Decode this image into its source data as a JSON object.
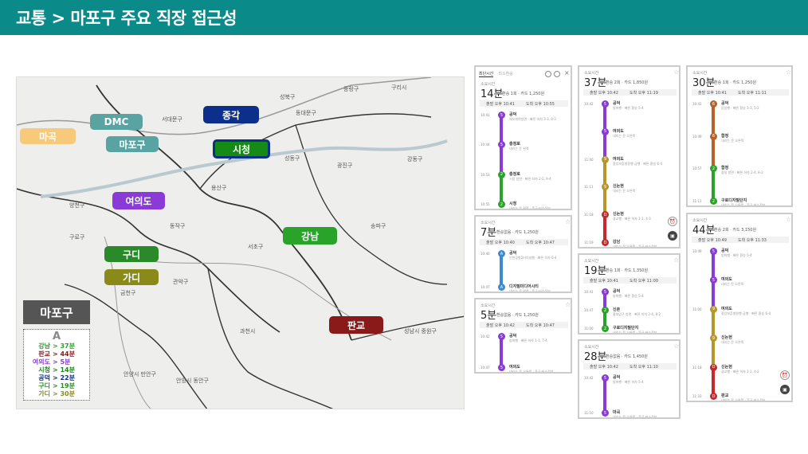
{
  "header": {
    "title": "교통 > 마포구 주요 직장 접근성",
    "bg": "#0b8a8a"
  },
  "map": {
    "districts": [
      "성북구",
      "종랑구",
      "구리시",
      "동대문구",
      "서대문구",
      "성동구",
      "광진구",
      "강동구",
      "용산구",
      "양천구",
      "송파구",
      "구로구",
      "동작구",
      "서초구",
      "관악구",
      "금천구",
      "과천시",
      "성남시 중원구",
      "안양시 만안구",
      "안양시 동안구"
    ],
    "pills": [
      {
        "label": "종각",
        "color": "#0b2f8a"
      },
      {
        "label": "DMC",
        "color": "#5aa3a3"
      },
      {
        "label": "마곡",
        "color": "#f7c97a"
      },
      {
        "label": "마포구",
        "color": "#5aa3a3"
      },
      {
        "label": "시청",
        "color": "#158a15"
      },
      {
        "label": "여의도",
        "color": "#8a3ad6"
      },
      {
        "label": "강남",
        "color": "#2aa32a"
      },
      {
        "label": "구디",
        "color": "#2a8a2a"
      },
      {
        "label": "가디",
        "color": "#8a8a1a"
      },
      {
        "label": "판교",
        "color": "#8a1a1a"
      }
    ],
    "box": {
      "title": "마포구",
      "letter": "A",
      "legend": [
        {
          "place": "강남",
          "time": "> 37분",
          "color": "#2aa32a"
        },
        {
          "place": "판교",
          "time": "> 44분",
          "color": "#8a1a1a"
        },
        {
          "place": "여의도",
          "time": "> 5분",
          "color": "#8a3ad6"
        },
        {
          "place": "시청",
          "time": "> 14분",
          "color": "#158a15"
        },
        {
          "place": "공덕",
          "time": "> 22분",
          "color": "#0b2f8a"
        },
        {
          "place": "구디",
          "time": "> 19분",
          "color": "#2a8a2a"
        },
        {
          "place": "가디",
          "time": "> 30분",
          "color": "#8a8a1a"
        }
      ]
    }
  },
  "cards": [
    {
      "tabs": [
        "최단시간",
        "최소환승"
      ],
      "label": "소요시간",
      "time": "14분",
      "meta": "환승 1회 · 카드 1,250원",
      "depart": "출발 오후 10:41",
      "arrive": "도착 오후 10:55",
      "stops": [
        {
          "name": "공덕",
          "sub": "애오개역방면 · 빠른 하차 3-3, 8-3",
          "color": "#8a3ad6",
          "badge": "5",
          "time": "10:41"
        },
        {
          "name": "충정로",
          "sub": "내리는 문 왼쪽",
          "color": "#8a3ad6",
          "badge": "5",
          "time": "10:44"
        },
        {
          "name": "충정로",
          "sub": "시청 방면 · 빠른 하차 2-2, 9-4",
          "color": "#2aa32a",
          "badge": "2",
          "time": "10:53"
        },
        {
          "name": "시청",
          "sub": "내리는 문 왼쪽 · 출구·버스정보",
          "color": "#2aa32a",
          "badge": "2",
          "time": "10:55"
        }
      ]
    },
    {
      "label": "소요시간",
      "time": "7분",
      "meta": "환승없음 · 카드 1,250원",
      "depart": "출발 오후 10:40",
      "arrive": "도착 오후 10:47",
      "stops": [
        {
          "name": "공덕",
          "sub": "인천공항2터미널행 · 빠른 하차 6-4",
          "color": "#3a8ad6",
          "badge": "A",
          "time": "10:40"
        },
        {
          "name": "디지털미디어시티",
          "sub": "내리는 문 왼쪽 · 출구·버스정보",
          "color": "#3a8ad6",
          "badge": "A",
          "time": "10:47"
        }
      ]
    },
    {
      "label": "소요시간",
      "time": "5분",
      "meta": "환승없음 · 카드 1,250원",
      "depart": "출발 오후 10:42",
      "arrive": "도착 오후 10:47",
      "stops": [
        {
          "name": "공덕",
          "sub": "방화행 · 빠른 하차 1-1, 7-4",
          "color": "#8a3ad6",
          "badge": "5",
          "time": "10:42"
        },
        {
          "name": "여의도",
          "sub": "내리는 문 오른쪽 · 출구·버스정보",
          "color": "#8a3ad6",
          "badge": "5",
          "time": "10:47"
        }
      ]
    },
    {
      "label": "소요시간",
      "time": "37분",
      "meta": "환승 2회 · 카드 1,850원",
      "depart": "출발 오후 10:42",
      "arrive": "도착 오후 11:19",
      "stops": [
        {
          "name": "공덕",
          "sub": "방화행 · 빠른 환승 5-4",
          "color": "#8a3ad6",
          "badge": "5",
          "time": "10:42"
        },
        {
          "name": "여의도",
          "sub": "내리는 문 오른쪽",
          "color": "#8a3ad6",
          "badge": "5",
          "time": ""
        },
        {
          "name": "여의도",
          "sub": "중앙보훈병원행 급행 · 빠른 환승 6-4",
          "color": "#b8962a",
          "badge": "9",
          "time": "11:00"
        },
        {
          "name": "신논현",
          "sub": "내리는 문 오른쪽",
          "color": "#b8962a",
          "badge": "9",
          "time": "11:11"
        },
        {
          "name": "신논현",
          "sub": "광교행 · 빠른 하차 1-1, 4-3",
          "color": "#c8282a",
          "badge": "D",
          "time": "11:18"
        },
        {
          "name": "강남",
          "sub": "내리는 문 오른쪽 · 출구·버스정보",
          "color": "#c8282a",
          "badge": "D",
          "time": "11:19"
        }
      ]
    },
    {
      "label": "소요시간",
      "time": "19분",
      "meta": "환승 1회 · 카드 1,350원",
      "depart": "출발 오후 10:41",
      "arrive": "도착 오후 11:00",
      "stops": [
        {
          "name": "공덕",
          "sub": "방화행 · 빠른 환승 5-4",
          "color": "#8a3ad6",
          "badge": "5",
          "time": "10:41"
        },
        {
          "name": "신촌",
          "sub": "홍대입구 방면 · 빠른 하차 2-4, 8-2",
          "color": "#2aa32a",
          "badge": "2",
          "time": "10:47"
        },
        {
          "name": "구로디지털단지",
          "sub": "내리는 문 오른쪽 · 출구·버스정보",
          "color": "#2aa32a",
          "badge": "2",
          "time": "11:00"
        }
      ]
    },
    {
      "label": "소요시간",
      "time": "28분",
      "meta": "환승없음 · 카드 1,450원",
      "depart": "출발 오후 10:42",
      "arrive": "도착 오후 11:10",
      "stops": [
        {
          "name": "공덕",
          "sub": "방화행 · 빠른 하차 5-4",
          "color": "#8a3ad6",
          "badge": "5",
          "time": "10:42"
        },
        {
          "name": "마곡",
          "sub": "내리는 문 오른쪽 · 출구·버스정보",
          "color": "#8a3ad6",
          "badge": "5",
          "time": "11:10"
        }
      ]
    },
    {
      "label": "소요시간",
      "time": "30분",
      "meta": "환승 1회 · 카드 1,250원",
      "depart": "출발 오후 10:41",
      "arrive": "도착 오후 11:11",
      "stops": [
        {
          "name": "공덕",
          "sub": "응암행 · 빠른 환승 3-3, 5-2",
          "color": "#b8622a",
          "badge": "6",
          "time": "10:41"
        },
        {
          "name": "합정",
          "sub": "내리는 문 오른쪽",
          "color": "#b8622a",
          "badge": "6",
          "time": "10:49"
        },
        {
          "name": "합정",
          "sub": "잠실 방면 · 빠른 하차 2-4, 8-2",
          "color": "#2aa32a",
          "badge": "2",
          "time": "10:57"
        },
        {
          "name": "구로디지털단지",
          "sub": "내리는 문 오른쪽 · 출구·버스정보",
          "color": "#2aa32a",
          "badge": "2",
          "time": "11:11"
        }
      ]
    },
    {
      "label": "소요시간",
      "time": "44분",
      "meta": "환승 2회 · 카드 3,150원",
      "depart": "출발 오후 10:49",
      "arrive": "도착 오후 11:33",
      "stops": [
        {
          "name": "공덕",
          "sub": "방화행 · 빠른 환승 5-4",
          "color": "#8a3ad6",
          "badge": "5",
          "time": "10:49"
        },
        {
          "name": "여의도",
          "sub": "내리는 문 오른쪽",
          "color": "#8a3ad6",
          "badge": "5",
          "time": ""
        },
        {
          "name": "여의도",
          "sub": "중앙보훈병원행 급행 · 빠른 환승 6-4",
          "color": "#b8962a",
          "badge": "9",
          "time": "11:00"
        },
        {
          "name": "신논현",
          "sub": "내리는 문 오른쪽",
          "color": "#b8962a",
          "badge": "9",
          "time": ""
        },
        {
          "name": "신논현",
          "sub": "광교행 · 빠른 하차 1-1, 4-2",
          "color": "#c8282a",
          "badge": "D",
          "time": "11:18"
        },
        {
          "name": "판교",
          "sub": "내리는 문 오른쪽 · 출구·버스정보",
          "color": "#c8282a",
          "badge": "D",
          "time": "11:33"
        }
      ]
    }
  ]
}
